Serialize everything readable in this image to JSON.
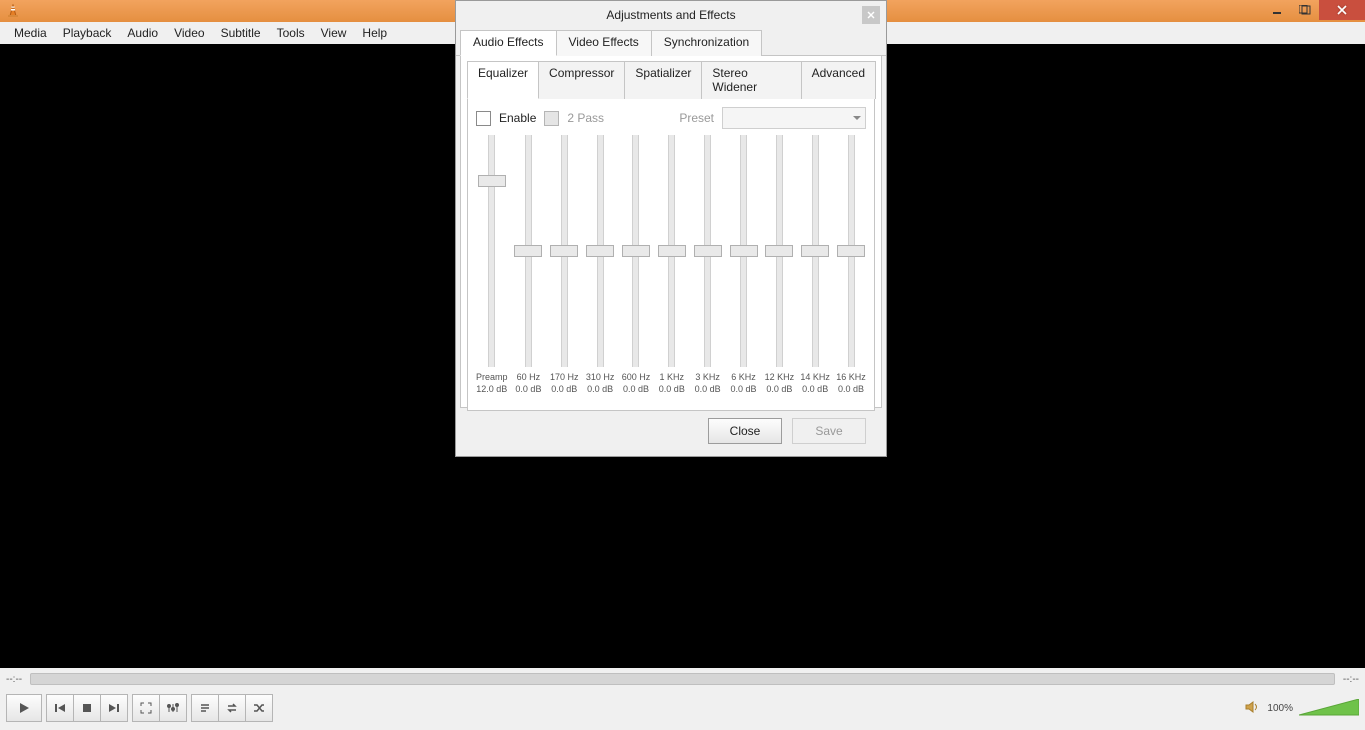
{
  "menu": {
    "items": [
      "Media",
      "Playback",
      "Audio",
      "Video",
      "Subtitle",
      "Tools",
      "View",
      "Help"
    ]
  },
  "transport": {
    "time_left": "--:--",
    "time_right": "--:--",
    "volume_label": "100%"
  },
  "dialog": {
    "title": "Adjustments and Effects",
    "tabs1": [
      "Audio Effects",
      "Video Effects",
      "Synchronization"
    ],
    "tabs2": [
      "Equalizer",
      "Compressor",
      "Spatializer",
      "Stereo Widener",
      "Advanced"
    ],
    "enable_label": "Enable",
    "twopass_label": "2 Pass",
    "preset_label": "Preset",
    "preamp": {
      "label": "Preamp",
      "value": "12.0 dB",
      "thumb_pct": 20
    },
    "bands": [
      {
        "freq": "60 Hz",
        "db": "0.0 dB",
        "thumb_pct": 50
      },
      {
        "freq": "170 Hz",
        "db": "0.0 dB",
        "thumb_pct": 50
      },
      {
        "freq": "310 Hz",
        "db": "0.0 dB",
        "thumb_pct": 50
      },
      {
        "freq": "600 Hz",
        "db": "0.0 dB",
        "thumb_pct": 50
      },
      {
        "freq": "1 KHz",
        "db": "0.0 dB",
        "thumb_pct": 50
      },
      {
        "freq": "3 KHz",
        "db": "0.0 dB",
        "thumb_pct": 50
      },
      {
        "freq": "6 KHz",
        "db": "0.0 dB",
        "thumb_pct": 50
      },
      {
        "freq": "12 KHz",
        "db": "0.0 dB",
        "thumb_pct": 50
      },
      {
        "freq": "14 KHz",
        "db": "0.0 dB",
        "thumb_pct": 50
      },
      {
        "freq": "16 KHz",
        "db": "0.0 dB",
        "thumb_pct": 50
      }
    ],
    "close_button": "Close",
    "save_button": "Save"
  }
}
